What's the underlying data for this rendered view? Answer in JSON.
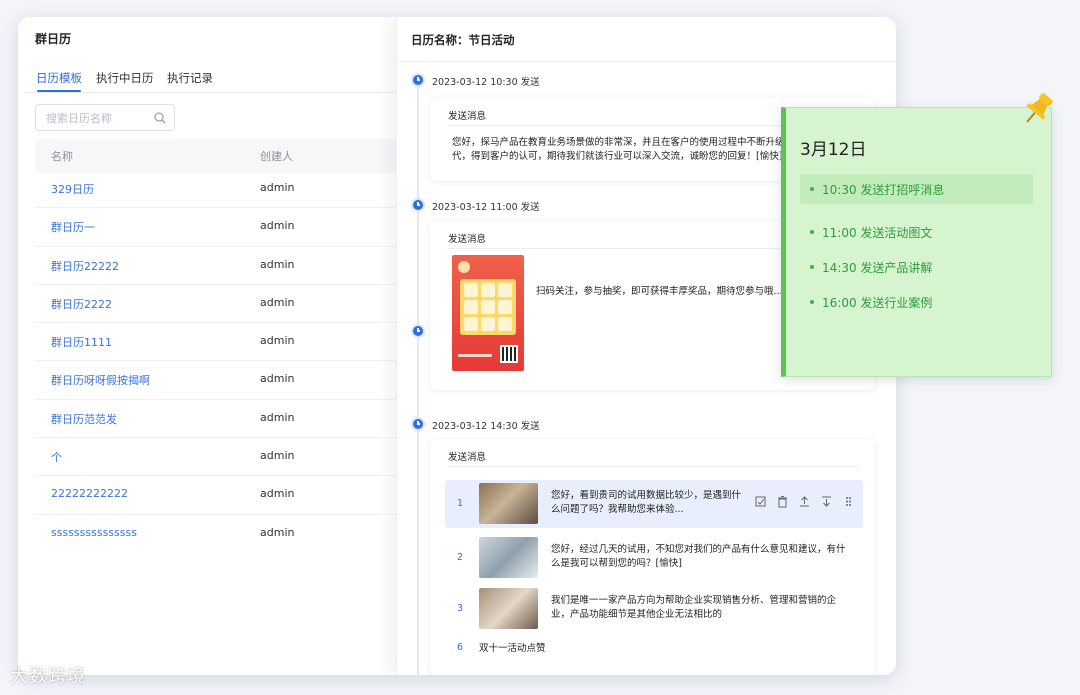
{
  "left": {
    "title": "群日历",
    "tabs": [
      {
        "label": "日历模板",
        "active": true
      },
      {
        "label": "执行中日历",
        "active": false
      },
      {
        "label": "执行记录",
        "active": false
      }
    ],
    "search_placeholder": "搜索日历名称",
    "columns": {
      "name": "名称",
      "creator": "创建人"
    },
    "rows": [
      {
        "name": "329日历",
        "creator": "admin"
      },
      {
        "name": "群日历一",
        "creator": "admin"
      },
      {
        "name": "群日历22222",
        "creator": "admin"
      },
      {
        "name": "群日历2222",
        "creator": "admin"
      },
      {
        "name": "群日历1111",
        "creator": "admin"
      },
      {
        "name": "群日历呀呀假按揭啊",
        "creator": "admin"
      },
      {
        "name": "群日历范范发",
        "creator": "admin"
      },
      {
        "name": "个",
        "creator": "admin"
      },
      {
        "name": "22222222222",
        "creator": "admin"
      },
      {
        "name": "sssssssssssssss",
        "creator": "admin"
      }
    ]
  },
  "right": {
    "title": "日历名称：节日活动",
    "events": [
      {
        "time": "2023-03-12 10:30 发送",
        "card_head": "发送消息",
        "text": "您好，探马产品在教育业务场景做的非常深，并且在客户的使用过程中不断升级迭代，得到客户的认可，期待我们就该行业可以深入交流，诚盼您的回复！[愉快]"
      },
      {
        "time": "2023-03-12 11:00 发送",
        "card_head": "发送消息",
        "text": "扫码关注，参与抽奖，即可获得丰厚奖品，期待您参与哦..."
      },
      {
        "time": "2023-03-12 14:30 发送",
        "card_head": "发送消息",
        "messages": [
          {
            "num": "1",
            "text": "您好，看到贵司的试用数据比较少，是遇到什么问题了吗？我帮助您来体验..."
          },
          {
            "num": "2",
            "text": "您好，经过几天的试用，不知您对我们的产品有什么意见和建议，有什么是我可以帮到您的吗？[愉快]"
          },
          {
            "num": "3",
            "text": "我们是唯一一家产品方向为帮助企业实现销售分析、管理和营销的企业，产品功能细节是其他企业无法相比的"
          },
          {
            "num": "6",
            "text": "双十一活动点赞"
          }
        ]
      }
    ]
  },
  "sticky": {
    "date": "3月12日",
    "items": [
      {
        "label": "10:30 发送打招呼消息",
        "highlight": true
      },
      {
        "label": "11:00 发送活动图文",
        "highlight": false
      },
      {
        "label": "14:30 发送产品讲解",
        "highlight": false
      },
      {
        "label": "16:00 发送行业案例",
        "highlight": false
      }
    ]
  },
  "watermark": "大数跨境",
  "colors": {
    "accent": "#2f6fde",
    "sticky_bg": "#d6f4d0",
    "sticky_text": "#2f9c3a",
    "pin": "#f5c426"
  }
}
